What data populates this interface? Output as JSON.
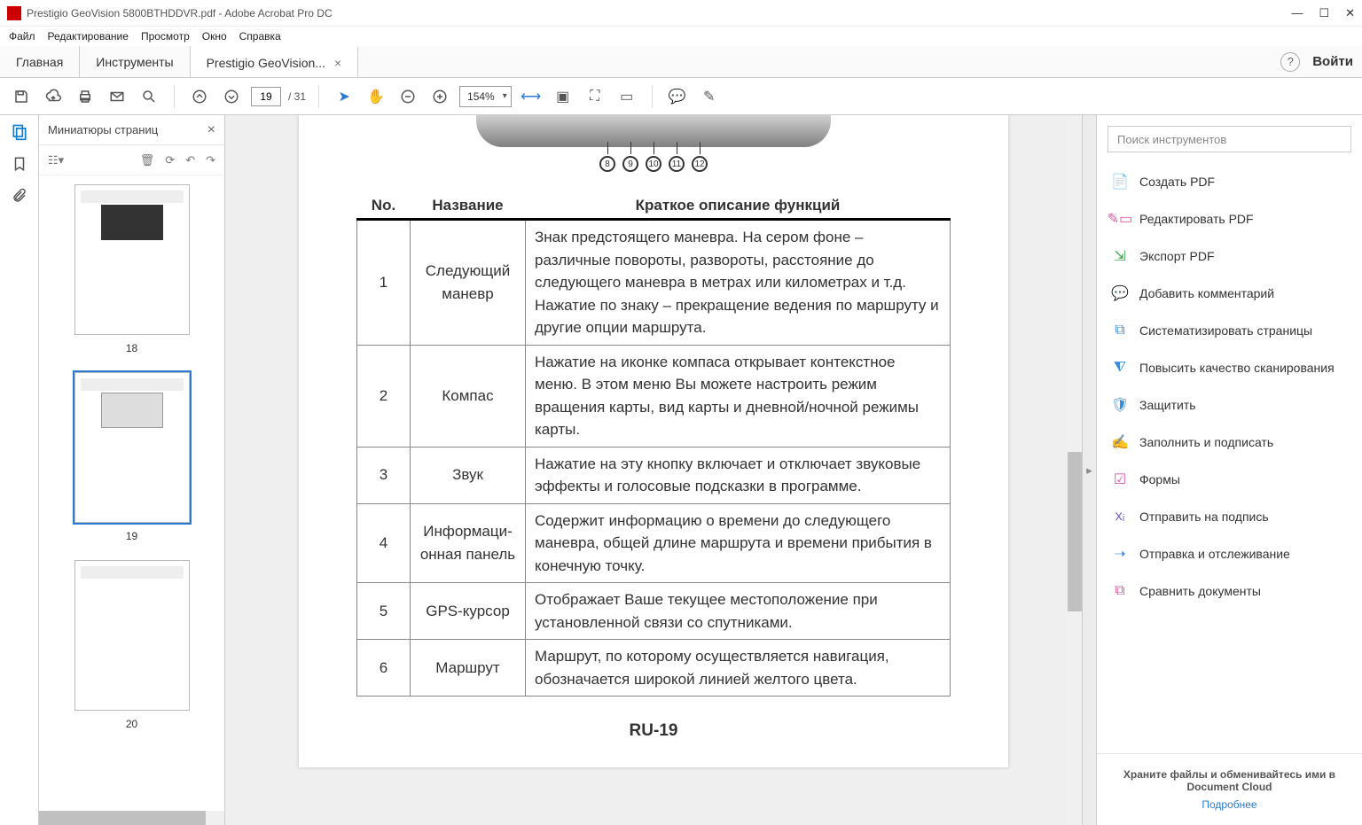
{
  "window": {
    "title": "Prestigio GeoVision 5800BTHDDVR.pdf - Adobe Acrobat Pro DC",
    "login": "Войти"
  },
  "menu": [
    "Файл",
    "Редактирование",
    "Просмотр",
    "Окно",
    "Справка"
  ],
  "tabs": {
    "home": "Главная",
    "tools": "Инструменты",
    "doc": "Prestigio GeoVision..."
  },
  "toolbar": {
    "page": "19",
    "total": "/ 31",
    "zoom": "154%"
  },
  "thumbs": {
    "title": "Миниатюры страниц",
    "nums": [
      "18",
      "19",
      "20"
    ]
  },
  "rp": {
    "search": "Поиск инструментов",
    "items": [
      "Создать PDF",
      "Редактировать PDF",
      "Экспорт PDF",
      "Добавить комментарий",
      "Систематизировать страницы",
      "Повысить качество сканирования",
      "Защитить",
      "Заполнить и подписать",
      "Формы",
      "Отправить на подпись",
      "Отправка и отслеживание",
      "Сравнить документы"
    ],
    "foot": "Храните файлы и обменивайтесь ими в Document Cloud",
    "more": "Подробнее"
  },
  "doc": {
    "pins": [
      "8",
      "9",
      "10",
      "11",
      "12"
    ],
    "headers": [
      "No.",
      "Название",
      "Краткое описание функций"
    ],
    "rows": [
      {
        "n": "1",
        "name": "Следующий маневр",
        "desc": "Знак предстоящего маневра. На сером фоне – различные повороты, развороты, расстояние до следующего маневра в метрах или километрах и т.д. Нажатие по знаку – прекращение ведения по маршруту и другие опции маршрута."
      },
      {
        "n": "2",
        "name": "Компас",
        "desc": "Нажатие на иконке компаса открывает контекстное меню. В этом меню Вы можете настроить режим вращения карты, вид карты и дневной/ночной режимы карты."
      },
      {
        "n": "3",
        "name": "Звук",
        "desc": "Нажатие на эту кнопку включает и отключает звуковые эффекты и голосовые подсказки в программе."
      },
      {
        "n": "4",
        "name": "Информаци­онная панель",
        "desc": "Содержит информацию о времени до следующего маневра, общей длине маршрута и времени прибытия в конечную точку."
      },
      {
        "n": "5",
        "name": "GPS-курсор",
        "desc": "Отображает Ваше текущее местоположение при установ­ленной связи со спутниками."
      },
      {
        "n": "6",
        "name": "Маршрут",
        "desc": "Маршрут, по которому осуществляется навигация, обозна­чается широкой линией желтого цвета."
      }
    ],
    "pagenum": "RU-19"
  }
}
